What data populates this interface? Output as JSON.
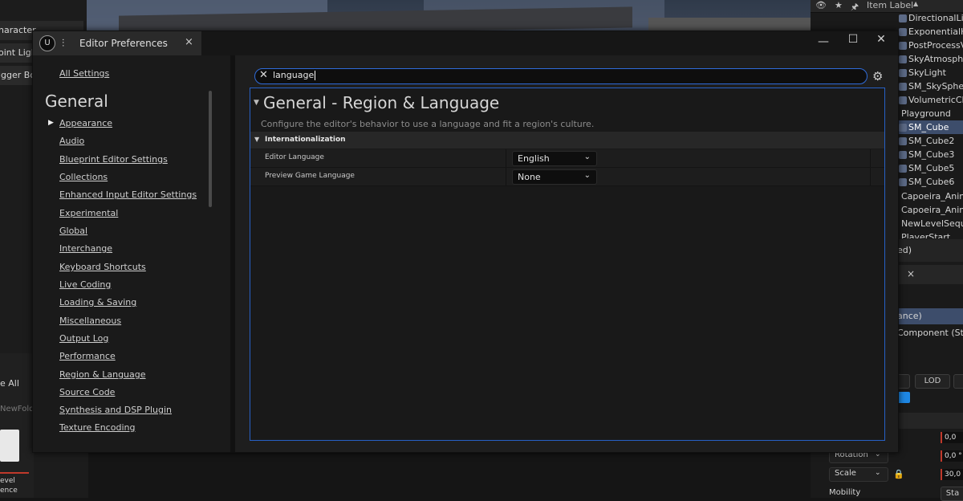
{
  "background": {
    "left_items": [
      "haracter",
      "oint Light",
      "igger Bo"
    ],
    "left_bottom": {
      "save_all": "e All",
      "folder": "NewFolde",
      "asset_label_line1": "evel",
      "asset_label_line2": "ence"
    },
    "outliner": {
      "header_label": "Item Label",
      "items": [
        "DirectionalLig",
        "ExponentialH",
        "PostProcessV",
        "SkyAtmosphe",
        "SkyLight",
        "SM_SkySpher",
        "VolumetricClo",
        "Playground",
        "SM_Cube",
        "SM_Cube2",
        "SM_Cube3",
        "SM_Cube5",
        "SM_Cube6",
        "Capoeira_Anim",
        "Capoeira_AnimT",
        "NewLevelSeque",
        "PlayerStart"
      ],
      "selected": "SM_Cube",
      "status": "ed)"
    },
    "details": {
      "instance_label": "ance)",
      "component_label": "Component (Sta",
      "lod_label": "LOD",
      "rotation_label": "Rotation",
      "scale_label": "Scale",
      "mobility_label": "Mobility",
      "value_location": "0,0",
      "value_rotation": "0,0 °",
      "value_scale": "30,0",
      "mobility_btn": "Sta"
    }
  },
  "dialog": {
    "logo": "U",
    "tab_icon": "⫶",
    "tab_title": "Editor Preferences",
    "tab_close": "×",
    "window_buttons": {
      "minimize": "—",
      "maximize": "☐",
      "close": "✕"
    },
    "sidebar": {
      "all_settings": "All Settings",
      "section": "General",
      "categories": [
        "Appearance",
        "Audio",
        "Blueprint Editor Settings",
        "Collections",
        "Enhanced Input Editor Settings",
        "Experimental",
        "Global",
        "Interchange",
        "Keyboard Shortcuts",
        "Live Coding",
        "Loading & Saving",
        "Miscellaneous",
        "Output Log",
        "Performance",
        "Region & Language",
        "Source Code",
        "Synthesis and DSP Plugin",
        "Texture Encoding"
      ]
    },
    "search": {
      "value": "language",
      "clear_icon": "✕",
      "gear_icon": "⚙"
    },
    "section": {
      "title": "General - Region & Language",
      "description": "Configure the editor's behavior to use a language and fit a region's culture.",
      "category": "Internationalization",
      "properties": [
        {
          "label": "Editor Language",
          "value": "English"
        },
        {
          "label": "Preview Game Language",
          "value": "None"
        }
      ]
    }
  },
  "colors": {
    "accent": "#2761c6",
    "selected": "#3d4d6b"
  }
}
